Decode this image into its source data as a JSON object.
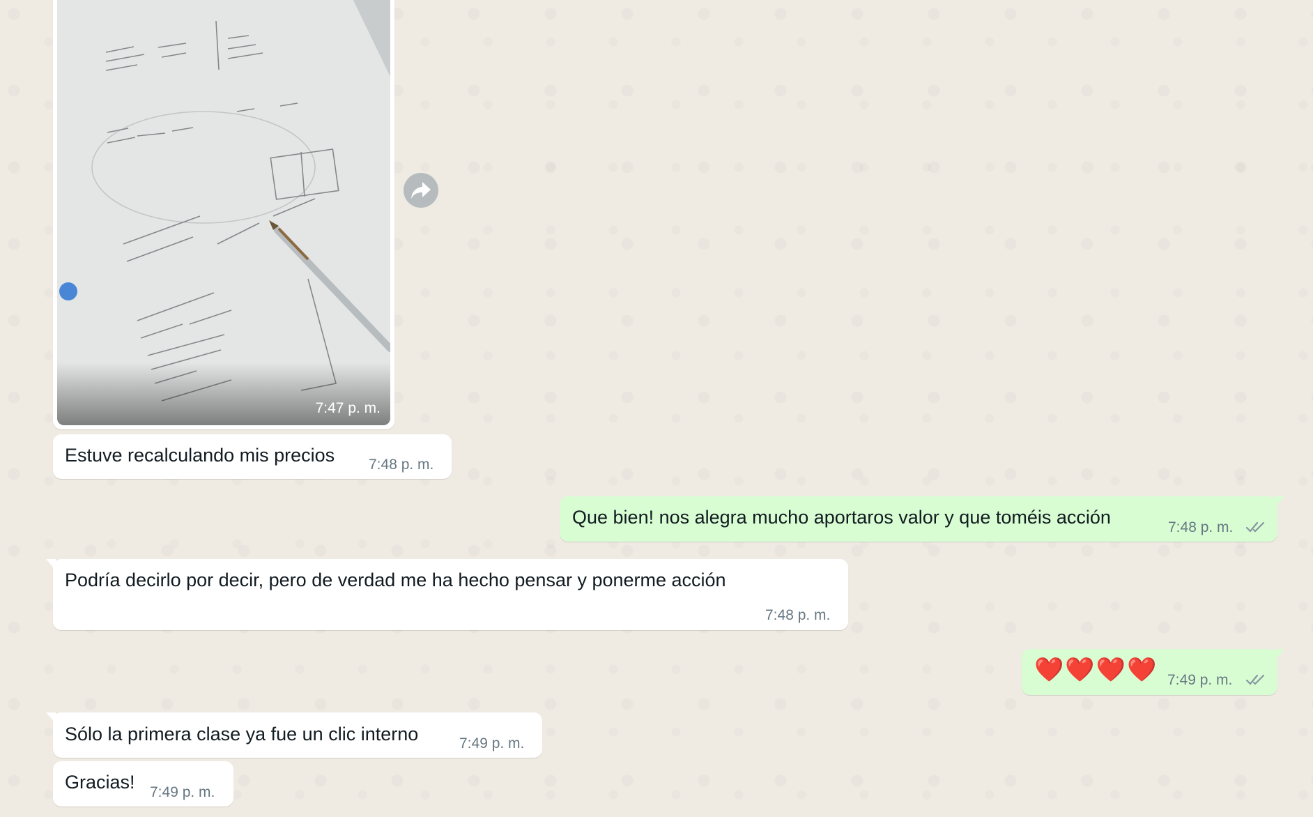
{
  "chat": {
    "image_message": {
      "time": "7:47 p. m.",
      "icons": {
        "forward": "forward-icon"
      }
    },
    "messages": [
      {
        "direction": "in",
        "text": "Estuve recalculando mis precios",
        "time": "7:48 p. m."
      },
      {
        "direction": "out",
        "text": "Que bien! nos alegra mucho aportaros valor y que toméis acción",
        "time": "7:48 p. m.",
        "status": "read"
      },
      {
        "direction": "in",
        "text": "Podría decirlo por decir, pero de verdad me ha hecho pensar y ponerme acción",
        "time": "7:48 p. m."
      },
      {
        "direction": "out",
        "text": "❤️❤️❤️❤️",
        "time": "7:49 p. m.",
        "status": "read"
      },
      {
        "direction": "in",
        "text": "Sólo la primera clase ya fue un clic interno",
        "time": "7:49 p. m."
      },
      {
        "direction": "in",
        "text": "Gracias!",
        "time": "7:49 p. m."
      }
    ]
  },
  "colors": {
    "background": "#efeae2",
    "incoming_bubble": "#ffffff",
    "outgoing_bubble": "#d9fdd3",
    "timestamp": "#667781",
    "read_ticks": "#8696a0"
  }
}
